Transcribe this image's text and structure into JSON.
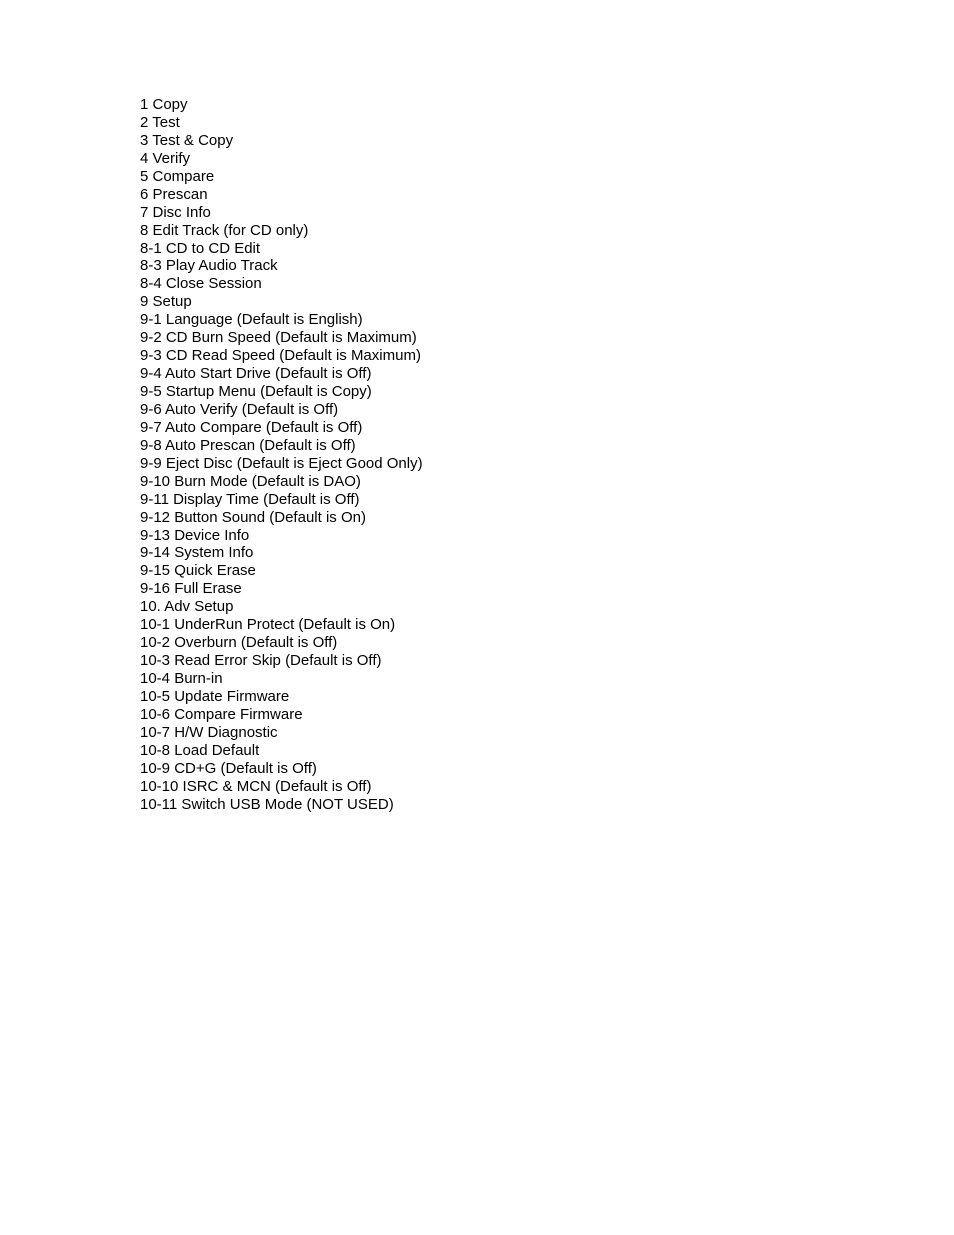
{
  "document": {
    "menu_items": [
      {
        "label": "1 Copy"
      },
      {
        "label": "2 Test"
      },
      {
        "label": "3 Test & Copy"
      },
      {
        "label": "4 Verify"
      },
      {
        "label": "5 Compare"
      },
      {
        "label": "6 Prescan"
      },
      {
        "label": "7 Disc Info"
      },
      {
        "label": "8 Edit Track (for CD only)"
      },
      {
        "label": "8-1 CD to CD Edit"
      },
      {
        "label": "8-3 Play Audio Track"
      },
      {
        "label": "8-4 Close Session"
      },
      {
        "label": "9 Setup"
      },
      {
        "label": "9-1 Language (Default is English)"
      },
      {
        "label": "9-2 CD Burn Speed (Default is Maximum)"
      },
      {
        "label": "9-3 CD Read Speed (Default is Maximum)"
      },
      {
        "label": "9-4 Auto Start Drive (Default is Off)"
      },
      {
        "label": "9-5 Startup Menu (Default is Copy)"
      },
      {
        "label": "9-6 Auto Verify (Default is Off)"
      },
      {
        "label": "9-7 Auto Compare (Default is Off)"
      },
      {
        "label": "9-8 Auto Prescan (Default is Off)"
      },
      {
        "label": "9-9 Eject Disc (Default is Eject Good Only)"
      },
      {
        "label": "9-10 Burn Mode (Default is DAO)"
      },
      {
        "label": "9-11 Display Time (Default is Off)"
      },
      {
        "label": "9-12 Button Sound (Default is On)"
      },
      {
        "label": "9-13 Device Info"
      },
      {
        "label": "9-14 System Info"
      },
      {
        "label": "9-15 Quick Erase"
      },
      {
        "label": "9-16 Full Erase"
      },
      {
        "label": "10. Adv Setup"
      },
      {
        "label": "10-1 UnderRun Protect (Default is On)"
      },
      {
        "label": "10-2 Overburn (Default is Off)"
      },
      {
        "label": "10-3 Read Error Skip (Default is Off)"
      },
      {
        "label": "10-4 Burn-in"
      },
      {
        "label": "10-5 Update Firmware"
      },
      {
        "label": "10-6 Compare Firmware"
      },
      {
        "label": "10-7 H/W Diagnostic"
      },
      {
        "label": "10-8 Load Default"
      },
      {
        "label": "10-9 CD+G (Default is Off)"
      },
      {
        "label": "10-10 ISRC & MCN (Default is Off)"
      },
      {
        "label": "10-11 Switch USB Mode (NOT USED)"
      }
    ]
  }
}
